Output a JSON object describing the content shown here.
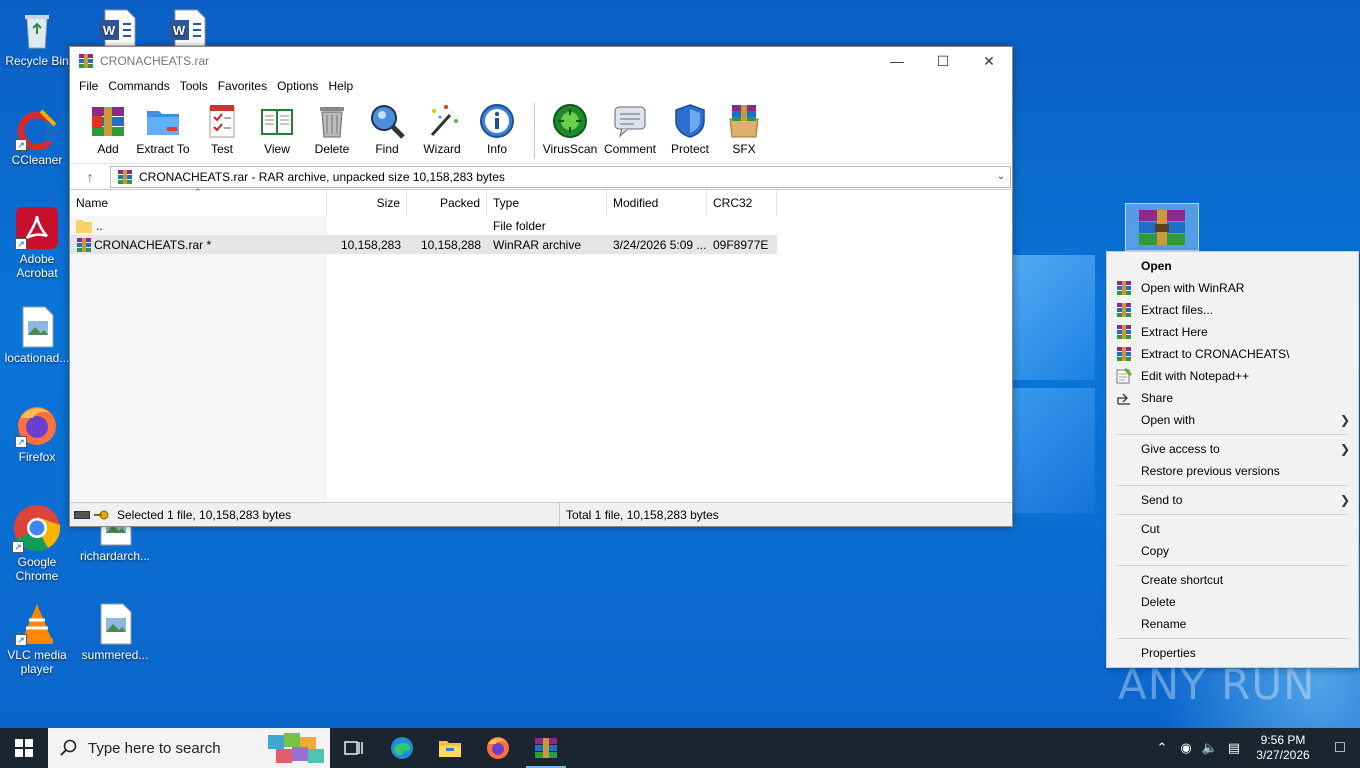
{
  "desktop": {
    "icons": [
      {
        "label": "Recycle Bin"
      },
      {
        "label": "CCleaner"
      },
      {
        "label": "Adobe Acrobat"
      },
      {
        "label": "locationad..."
      },
      {
        "label": "Firefox"
      },
      {
        "label": "Google Chrome"
      },
      {
        "label": "richardarch..."
      },
      {
        "label": "VLC media player"
      },
      {
        "label": "summered..."
      }
    ],
    "watermark": "ANY RUN"
  },
  "window": {
    "title": "CRONACHEATS.rar",
    "menu": [
      "File",
      "Commands",
      "Tools",
      "Favorites",
      "Options",
      "Help"
    ],
    "toolbar": [
      {
        "label": "Add",
        "icon": "add-icon"
      },
      {
        "label": "Extract To",
        "icon": "extract-to-icon"
      },
      {
        "label": "Test",
        "icon": "test-icon"
      },
      {
        "label": "View",
        "icon": "view-icon"
      },
      {
        "label": "Delete",
        "icon": "delete-icon"
      },
      {
        "label": "Find",
        "icon": "find-icon"
      },
      {
        "label": "Wizard",
        "icon": "wizard-icon"
      },
      {
        "label": "Info",
        "icon": "info-icon"
      },
      {
        "label": "VirusScan",
        "icon": "virusscan-icon"
      },
      {
        "label": "Comment",
        "icon": "comment-icon"
      },
      {
        "label": "Protect",
        "icon": "protect-icon"
      },
      {
        "label": "SFX",
        "icon": "sfx-icon"
      }
    ],
    "address": "CRONACHEATS.rar - RAR archive, unpacked size 10,158,283 bytes",
    "columns": [
      "Name",
      "Size",
      "Packed",
      "Type",
      "Modified",
      "CRC32"
    ],
    "rows": [
      {
        "name": "..",
        "size": "",
        "packed": "",
        "type": "File folder",
        "modified": "",
        "crc": ""
      },
      {
        "name": "CRONACHEATS.rar *",
        "size": "10,158,283",
        "packed": "10,158,288",
        "type": "WinRAR archive",
        "modified": "3/24/2026 5:09 ...",
        "crc": "09F8977E"
      }
    ],
    "status_left": "Selected 1 file, 10,158,283 bytes",
    "status_right": "Total 1 file, 10,158,283 bytes"
  },
  "context_menu": {
    "items": [
      {
        "label": "Open",
        "bold": true
      },
      {
        "label": "Open with WinRAR",
        "icon": "winrar-icon"
      },
      {
        "label": "Extract files...",
        "icon": "winrar-icon"
      },
      {
        "label": "Extract Here",
        "icon": "winrar-icon"
      },
      {
        "label": "Extract to CRONACHEATS\\",
        "icon": "winrar-icon"
      },
      {
        "label": "Edit with Notepad++",
        "icon": "notepadpp-icon"
      },
      {
        "label": "Share",
        "icon": "share-icon"
      },
      {
        "label": "Open with",
        "submenu": true
      },
      {
        "label": "Give access to",
        "submenu": true
      },
      {
        "label": "Restore previous versions"
      },
      {
        "label": "Send to",
        "submenu": true
      },
      {
        "label": "Cut"
      },
      {
        "label": "Copy"
      },
      {
        "label": "Create shortcut"
      },
      {
        "label": "Delete"
      },
      {
        "label": "Rename"
      },
      {
        "label": "Properties"
      }
    ]
  },
  "taskbar": {
    "search_placeholder": "Type here to search",
    "time": "9:56 PM",
    "date": "3/27/2026"
  }
}
